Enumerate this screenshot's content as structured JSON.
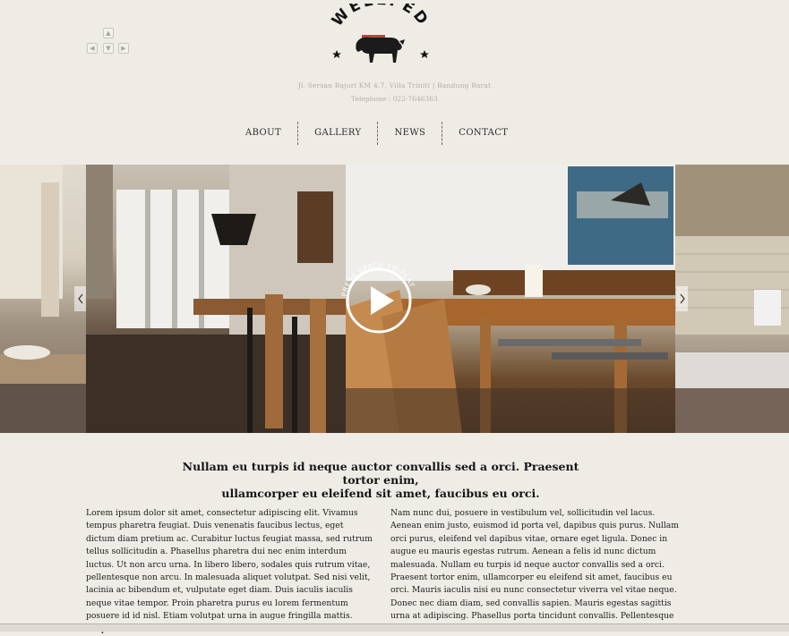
{
  "keys": {
    "up": "▲",
    "left": "◀",
    "down": "▼",
    "right": "▶"
  },
  "logo": {
    "text": "WELLFED"
  },
  "header": {
    "address": "Jl. Sersan Bajuri KM 4.7, Villa Triniti | Bandung Barat",
    "phone": "Telephone : 022-7646363"
  },
  "nav": {
    "items": [
      "ABOUT",
      "GALLERY",
      "NEWS",
      "CONTACT"
    ]
  },
  "gallery": {
    "play_hint": "PRESS SPACE TO PLAY"
  },
  "content": {
    "headline_line1": "Nullam eu turpis id neque auctor convallis sed a orci. Praesent tortor enim,",
    "headline_line2": "ullamcorper eu eleifend sit amet, faucibus eu orci.",
    "left_text": "Lorem ipsum dolor sit amet, consectetur adipiscing elit. Vivamus tempus pharetra feugiat. Duis venenatis faucibus lectus, eget dictum diam pretium ac. Curabitur luctus feugiat massa, sed rutrum tellus sollicitudin a. Phasellus pharetra dui nec enim interdum luctus. Ut non arcu urna. In libero libero, sodales quis rutrum vitae, pellentesque non arcu. In malesuada aliquet volutpat. Sed nisi velit, lacinia ac bibendum et, vulputate eget diam. Duis iaculis iaculis neque vitae tempor. Proin pharetra purus eu lorem fermentum posuere id id nisl. Etiam volutpat urna in augue fringilla mattis. Suspendisse eu orci vitae",
    "right_text": "Nam nunc dui, posuere in vestibulum vel, sollicitudin vel lacus. Aenean enim justo, euismod id porta vel, dapibus quis purus. Nullam orci purus, eleifend vel dapibus vitae, ornare eget ligula. Donec in augue eu mauris egestas rutrum. Aenean a felis id nunc dictum malesuada. Nullam eu turpis id neque auctor convallis sed a orci. Praesent tortor enim, ullamcorper eu eleifend sit amet, faucibus eu orci. Mauris iaculis nisi eu nunc consectetur viverra vel vitae neque. Donec nec diam diam, sed convallis sapien. Mauris egestas sagittis urna at adipiscing. Phasellus porta tincidunt convallis. Pellentesque"
  },
  "colors": {
    "background": "#efece6",
    "text": "#1d1d1d",
    "muted": "#b2aea6",
    "brand_red": "#b8302a"
  },
  "icons": [
    "arrow-up-icon",
    "arrow-left-icon",
    "arrow-down-icon",
    "arrow-right-icon",
    "cow-logo-icon",
    "star-icon",
    "play-icon",
    "chevron-left-icon",
    "chevron-right-icon"
  ]
}
